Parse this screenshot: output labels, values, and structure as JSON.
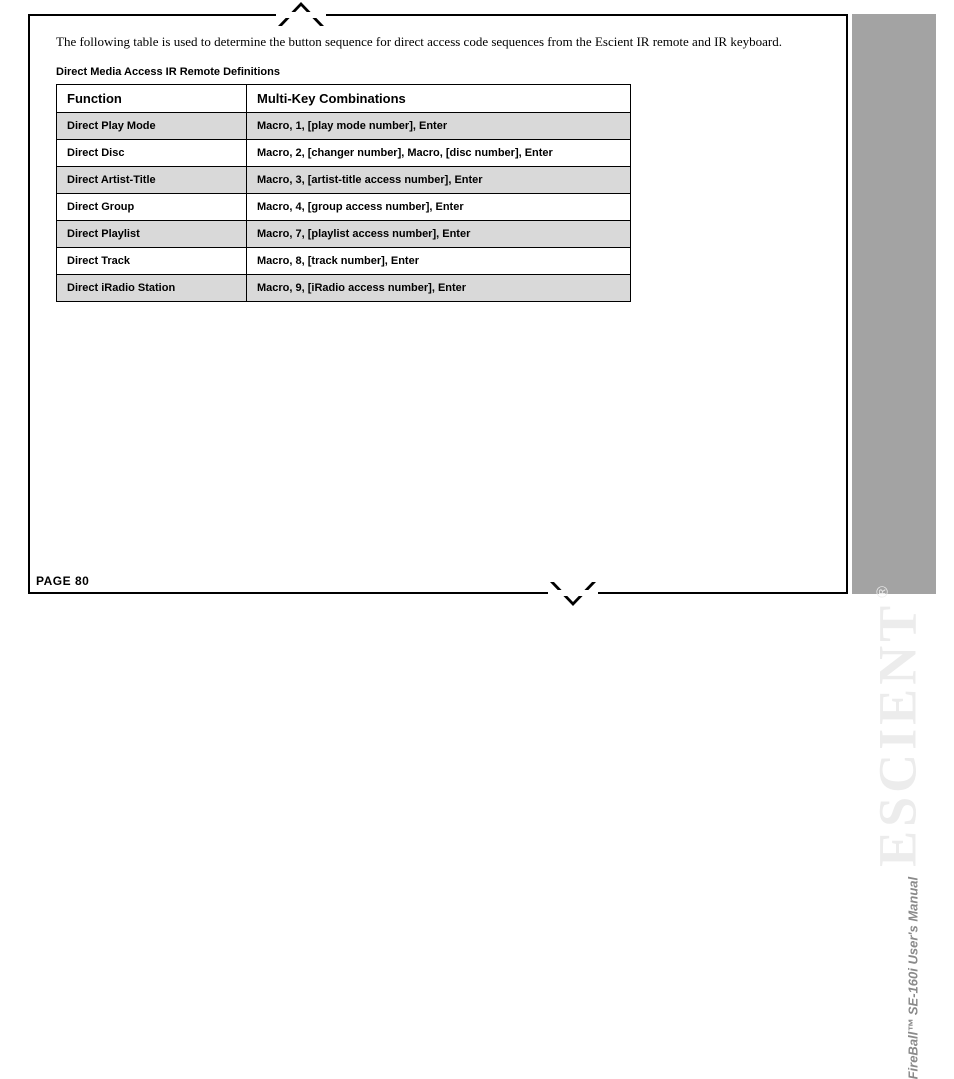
{
  "intro": "The following table is used to determine the button sequence for direct access code sequences from the Escient IR remote and IR keyboard.",
  "table": {
    "caption": "Direct Media Access IR Remote Definitions",
    "headers": {
      "fn": "Function",
      "combo": "Multi-Key Combinations"
    },
    "rows": [
      {
        "fn": "Direct Play Mode",
        "combo": "Macro, 1, [play mode number], Enter"
      },
      {
        "fn": "Direct Disc",
        "combo": "Macro, 2, [changer number], Macro, [disc number], Enter"
      },
      {
        "fn": "Direct Artist-Title",
        "combo": "Macro, 3, [artist-title access number], Enter"
      },
      {
        "fn": "Direct Group",
        "combo": "Macro, 4, [group access number], Enter"
      },
      {
        "fn": "Direct Playlist",
        "combo": "Macro, 7, [playlist access number], Enter"
      },
      {
        "fn": "Direct Track",
        "combo": "Macro, 8, [track number], Enter"
      },
      {
        "fn": "Direct iRadio Station",
        "combo": "Macro, 9, [iRadio access number], Enter"
      }
    ]
  },
  "footer": "PAGE 80",
  "sidebar": {
    "brand": "ESCIENT",
    "reg": "®",
    "subtitle": "FireBall™ SE-160i User's Manual"
  }
}
